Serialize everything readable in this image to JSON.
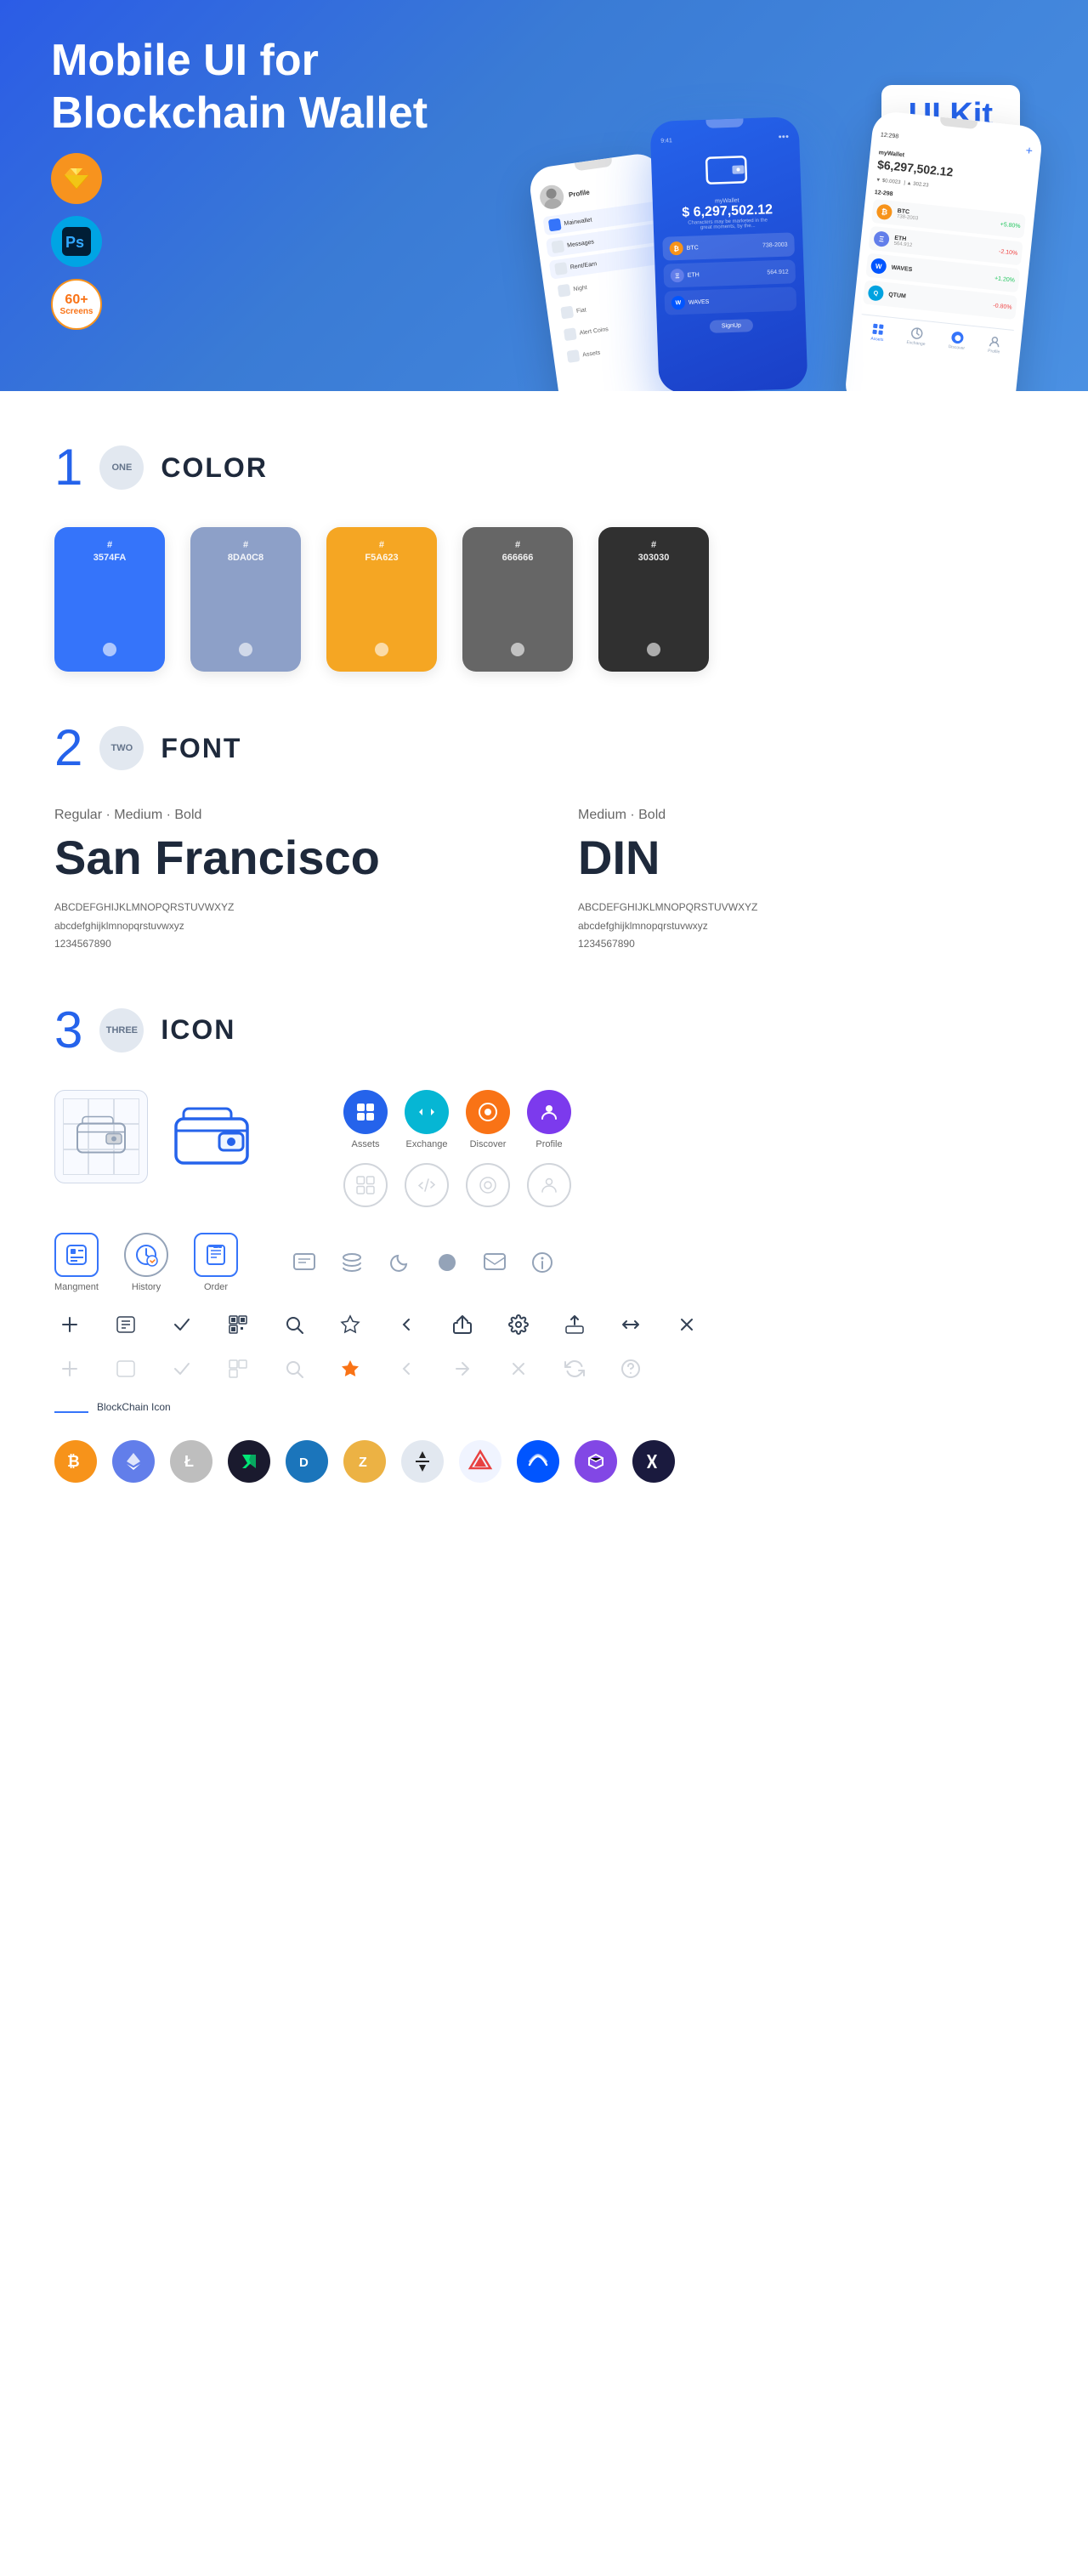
{
  "hero": {
    "title_normal": "Mobile UI for Blockchain",
    "title_bold": "Wallet",
    "badge": "UI Kit",
    "tool_sketch": "S",
    "tool_ps": "Ps",
    "screens_count": "60+",
    "screens_label": "Screens"
  },
  "section1": {
    "number": "1",
    "badge_label": "ONE",
    "title": "COLOR",
    "colors": [
      {
        "hex": "#3574FA",
        "label": "#\n3574FA",
        "dark_text": false
      },
      {
        "hex": "#8DA0C8",
        "label": "#\n8DA0C8",
        "dark_text": false
      },
      {
        "hex": "#F5A623",
        "label": "#\nF5A623",
        "dark_text": false
      },
      {
        "hex": "#666666",
        "label": "#\n666666",
        "dark_text": false
      },
      {
        "hex": "#303030",
        "label": "#\n303030",
        "dark_text": false
      }
    ]
  },
  "section2": {
    "number": "2",
    "badge_label": "TWO",
    "title": "FONT",
    "font1": {
      "styles": "Regular · Medium · Bold",
      "name": "San Francisco",
      "uppercase": "ABCDEFGHIJKLMNOPQRSTUVWXYZ",
      "lowercase": "abcdefghijklmnopqrstuvwxyz",
      "numbers": "1234567890"
    },
    "font2": {
      "styles": "Medium · Bold",
      "name": "DIN",
      "uppercase": "ABCDEFGHIJKLMNOPQRSTUVWXYZ",
      "lowercase": "abcdefghijklmnopqrstuvwxyz",
      "numbers": "1234567890"
    }
  },
  "section3": {
    "number": "3",
    "badge_label": "THREE",
    "title": "ICON",
    "nav_icons": [
      {
        "label": "Assets",
        "symbol": "◆"
      },
      {
        "label": "Exchange",
        "symbol": "♊"
      },
      {
        "label": "Discover",
        "symbol": "⊕"
      },
      {
        "label": "Profile",
        "symbol": "👤"
      }
    ],
    "app_icons": [
      {
        "label": "Mangment",
        "symbol": "▣"
      },
      {
        "label": "History",
        "symbol": "⏱"
      },
      {
        "label": "Order",
        "symbol": "📋"
      }
    ],
    "blockchain_label": "BlockChain Icon",
    "crypto": [
      {
        "symbol": "₿",
        "class": "cl-btc"
      },
      {
        "symbol": "Ξ",
        "class": "cl-eth"
      },
      {
        "symbol": "Ł",
        "class": "cl-ltc"
      },
      {
        "symbol": "N",
        "class": "cl-neo"
      },
      {
        "symbol": "D",
        "class": "cl-dash"
      },
      {
        "symbol": "Z",
        "class": "cl-zcash"
      },
      {
        "symbol": "◈",
        "class": "cl-iota"
      },
      {
        "symbol": "A",
        "class": "cl-ark"
      },
      {
        "symbol": "W",
        "class": "cl-waves"
      },
      {
        "symbol": "M",
        "class": "cl-matic"
      },
      {
        "symbol": "✕",
        "class": "cl-xrp"
      }
    ]
  }
}
